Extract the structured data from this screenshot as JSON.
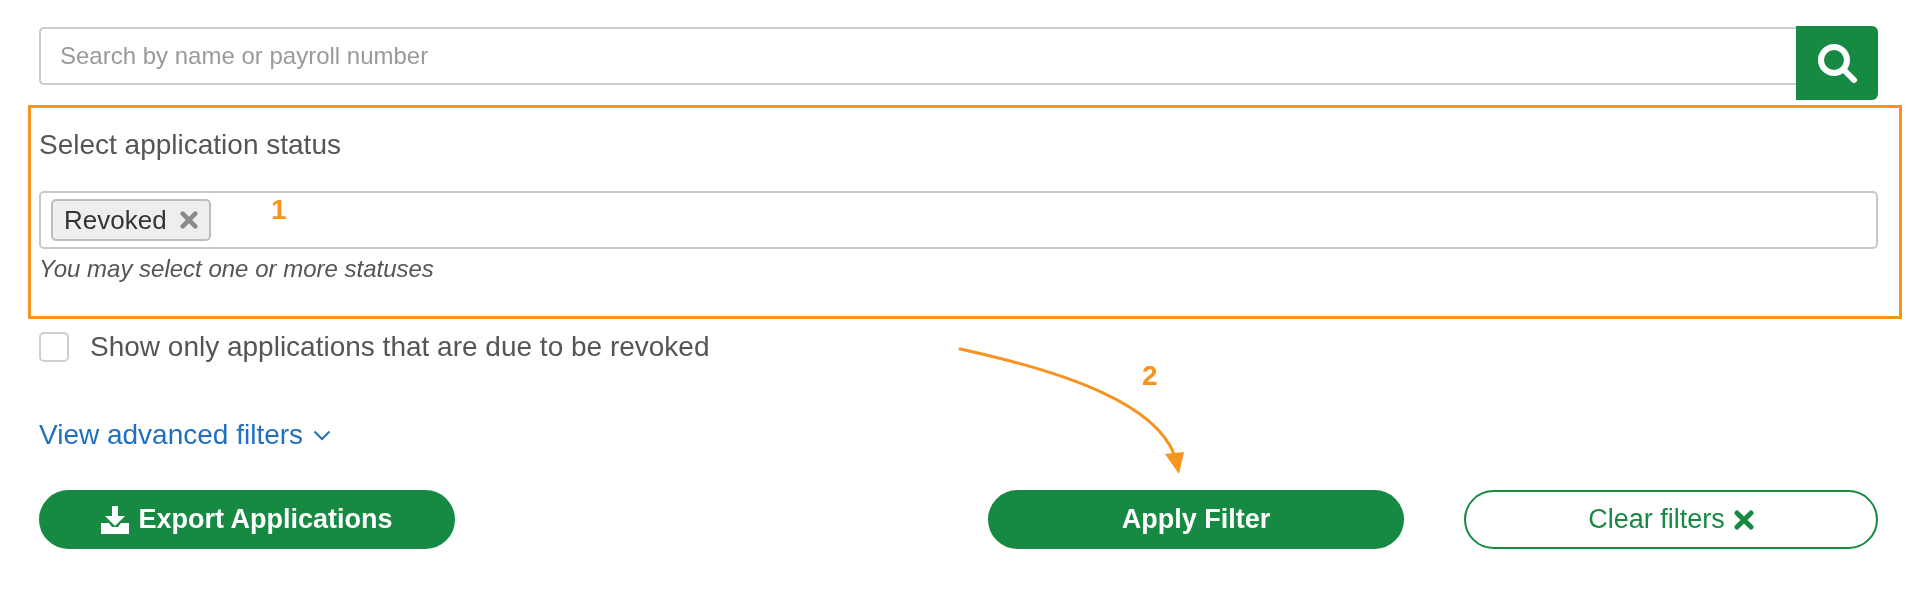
{
  "search": {
    "placeholder": "Search by name or payroll number"
  },
  "status_filter": {
    "highlighted": true,
    "title": "Select application status",
    "tags": [
      {
        "label": "Revoked"
      }
    ],
    "hint": "You may select one or more statuses"
  },
  "due_filter": {
    "label": "Show only applications that are due to be revoked",
    "checked": false
  },
  "advanced_link": {
    "label": "View advanced filters"
  },
  "buttons": [
    {
      "kind": "export",
      "label": "Export Applications"
    },
    {
      "kind": "apply",
      "label": "Apply Filter"
    },
    {
      "kind": "clear",
      "label": "Clear filters"
    }
  ],
  "annotations": [
    {
      "kind": "marker",
      "label": "1"
    },
    {
      "kind": "arrow",
      "label": "2"
    }
  ]
}
